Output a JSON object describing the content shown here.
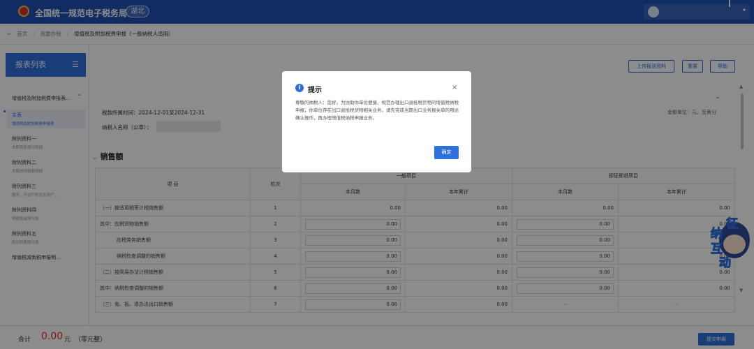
{
  "header": {
    "site_title": "全国统一规范电子税务局",
    "region": "湖北"
  },
  "breadcrumb": [
    "首页",
    "我要办税",
    "增值税及附加税费申报（一般纳税人适用）"
  ],
  "sidebar": {
    "title": "报表列表",
    "group": "增值税及附加税费申报表...",
    "items": [
      {
        "label": "主表",
        "sub": "增值税及附加税费申报表"
      },
      {
        "label": "附列资料一",
        "sub": "本期销售情况明细"
      },
      {
        "label": "附列资料二",
        "sub": "本期进项税额明细"
      },
      {
        "label": "附列资料三",
        "sub": "服务、不动产和无形资产..."
      },
      {
        "label": "附列资料四",
        "sub": "税额抵减情况表"
      },
      {
        "label": "附列资料五",
        "sub": "附加税费情况表"
      },
      {
        "label": "增值税减免税申报明..."
      }
    ]
  },
  "toolbar": {
    "upload": "上传报送资料",
    "reset": "重置",
    "help": "帮助"
  },
  "info": {
    "period_label": "税款所属时间：",
    "period_value": "2024-12-01至2024-12-31",
    "unit": "金额单位：元，至角分",
    "taxpayer_label": "纳税人名称（公章）："
  },
  "section_title": "销售额",
  "table": {
    "header_item": "项 目",
    "header_seq": "栏次",
    "header_general": "一般项目",
    "header_refund": "即征即退项目",
    "header_month": "本月数",
    "header_year": "本年累计",
    "rows": [
      {
        "name": "（一）按适用税率计税销售额",
        "seq": "1",
        "vals": [
          "0.00",
          "0.00",
          "0.00",
          "0.00"
        ]
      },
      {
        "name": "其中：应税货物销售额",
        "seq": "2",
        "vals": [
          "0.00",
          "0.00",
          "0.00",
          "0.00"
        ]
      },
      {
        "name": "应税劳务销售额",
        "seq": "3",
        "vals": [
          "0.00",
          "0.00",
          "0.00",
          "0.00"
        ]
      },
      {
        "name": "纳税检查调整的销售额",
        "seq": "4",
        "vals": [
          "0.00",
          "0.00",
          "0.00",
          "0.00"
        ]
      },
      {
        "name": "（二）按简易办法计税销售额",
        "seq": "5",
        "vals": [
          "0.00",
          "0.00",
          "0.00",
          "0.00"
        ]
      },
      {
        "name": "其中：纳税检查调整的销售额",
        "seq": "6",
        "vals": [
          "0.00",
          "0.00",
          "0.00",
          "0.00"
        ]
      },
      {
        "name": "（三）免、抵、退办法出口销售额",
        "seq": "7",
        "vals": [
          "0.00",
          "0.00",
          "--",
          "--"
        ]
      }
    ]
  },
  "footer": {
    "total_label": "合计",
    "total_amount": "0.00",
    "total_unit": "元",
    "total_words": "（零元整）",
    "submit": "提交申报"
  },
  "mascot": {
    "chars": [
      "征",
      "纳",
      "互",
      "动"
    ]
  },
  "dialog": {
    "icon": "i",
    "title": "提示",
    "close": "×",
    "message": "尊敬的纳税人：您好。为协助你单位便捷、规范办理出口退抵税货物的增值税纳税申报，你单位存在出口退抵税货物相关业务，请先完成当期出口业务报关单的用途确认操作，再办理增值税纳税申报业务。",
    "ok": "确定"
  }
}
